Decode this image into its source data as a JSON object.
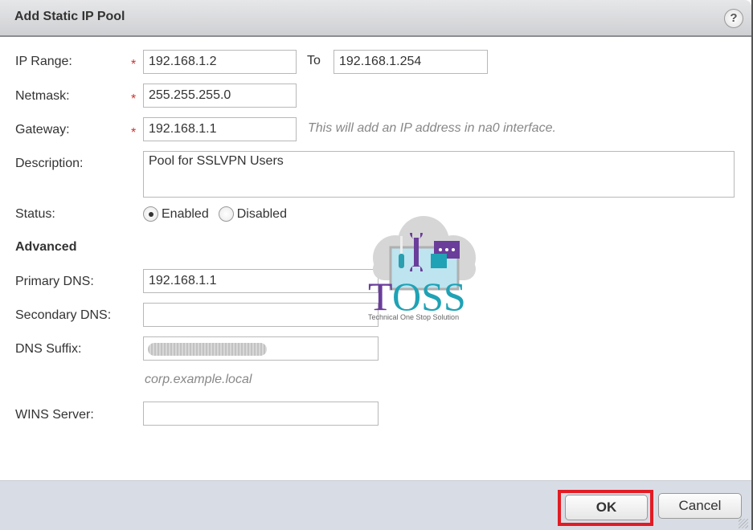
{
  "dialog": {
    "title": "Add Static IP Pool",
    "help_label": "?"
  },
  "form": {
    "ip_range": {
      "label": "IP Range:",
      "required_mark": "*",
      "from_value": "192.168.1.2",
      "to_label": "To",
      "to_value": "192.168.1.254"
    },
    "netmask": {
      "label": "Netmask:",
      "required_mark": "*",
      "value": "255.255.255.0"
    },
    "gateway": {
      "label": "Gateway:",
      "required_mark": "*",
      "value": "192.168.1.1",
      "hint": "This will add an IP address in na0 interface."
    },
    "description": {
      "label": "Description:",
      "value": "Pool for SSLVPN Users"
    },
    "status": {
      "label": "Status:",
      "options": [
        "Enabled",
        "Disabled"
      ],
      "selected": "Enabled"
    },
    "advanced": {
      "heading": "Advanced",
      "primary_dns": {
        "label": "Primary DNS:",
        "value": "192.168.1.1"
      },
      "secondary_dns": {
        "label": "Secondary DNS:",
        "value": ""
      },
      "dns_suffix": {
        "label": "DNS Suffix:",
        "value": "(redacted)",
        "hint": "corp.example.local"
      },
      "wins_server": {
        "label": "WINS Server:",
        "value": ""
      }
    }
  },
  "watermark": {
    "brand": "TOSS",
    "tagline": "Technical One Stop Solution"
  },
  "footer": {
    "ok_label": "OK",
    "cancel_label": "Cancel"
  },
  "colors": {
    "required": "#d03030",
    "highlight": "#e21b24",
    "footer_bg": "#d8dde5",
    "logo_purple": "#6a3d9a",
    "logo_teal": "#1fa2b5"
  }
}
